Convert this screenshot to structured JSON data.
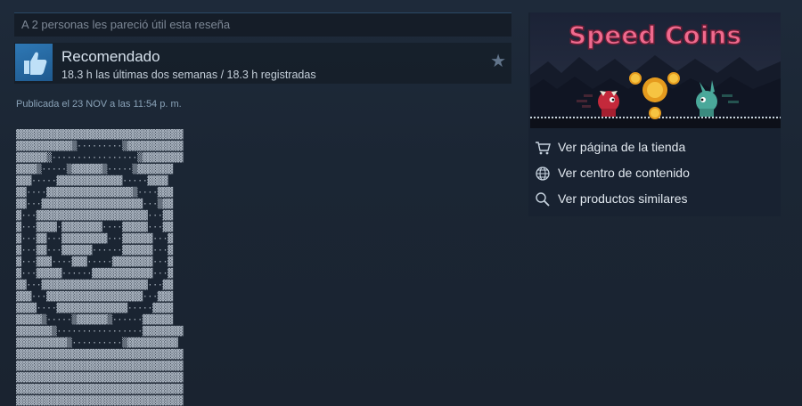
{
  "review": {
    "helpful_text": "A 2 personas les pareció útil esta reseña",
    "recommendation": "Recomendado",
    "hours": "18.3 h las últimas dos semanas / 18.3 h registradas",
    "posted": "Publicada el 23 NOV a las 11:54 p. m.",
    "ascii_art": "▓▓▓▓▓▓▓▓▓▓▓▓▓▓▓▓▓▓▓▓▓▓▓▓▓▓▓▓▓▓▓▓▓\n▓▓▓▓▓▓▓▓▓▓▓▒·········▒▓▓▓▓▓▓▓▓▓▓▓\n▓▓▓▓▓▓▒·················▒▓▓▓▓▓▓▓▓\n▓▓▓▓▒·····▒▓▓▓▓▓▓▒·····▒▓▓▓▓▓▓▓\n▓▓▓·····▓▓▓▓▓▓▓▓▓▓▓▓▓·····▓▓▓▓\n▓▓····▓▓▓▓▓▓▓▓▓▓▓▓▓▓▓▓▓▒····▓▓▓\n▓▓···▓▓▓▓▓▓▓▓▓▓▓▓▓▓▓▓▓▓▓▓···▒▓▓\n▓···▓▓▓▓▓▓▓▓▓▓▓▓▓▓▓▓▓▓▓▓▓▓···▓▓\n▓···▓▓▓▓·▓▓▓▓▓▓▓▓····▓▓▓▓▓···▓▓\n▓···▓▓···▓▓▓▓▓▓▓▓▓···▓▓▓▓▓▓···▓\n▓···▓▓···▓▓▓▓▓▓······▓▓▓▓▓▓···▓\n▓···▓▓▓····▓▓▓·····▓▓▓▓▓▓▓▓···▓\n▓···▓▓▓▓▓······▓▓▓▓▓▓▓▓▓▓▓▓···▓\n▓▓···▓▓▓▓▓▓▓▓▓▓▓▓▓▓▓▓▓▓▓▓▓···▓▓\n▓▓▓···▓▓▓▓▓▓▓▓▓▓▓▓▓▓▓▓▓▓▓···▓▓▓\n▓▓▓▓····▓▓▓▓▓▓▓▓▓▓▓▓▓▓·····▓▓▓▓\n▓▓▓▓▓▒·····▒▓▓▓▓▓▓▒······▓▓▓▓▓▓\n▓▓▓▓▓▓▓▒·················▓▓▓▓▓▓▓▓\n▓▓▓▓▓▓▓▓▓▓▒··········▒▓▓▓▓▓▓▓▓▓▓\n▓▓▓▓▓▓▓▓▓▓▓▓▓▓▓▓▓▓▓▓▓▓▓▓▓▓▓▓▓▓▓▓▓\n▓▓▓▓▓▓▓▓▓▓▓▓▓▓▓▓▓▓▓▓▓▓▓▓▓▓▓▓▓▓▓▓▓\n▓▓▓▓▓▓▓▓▓▓▓▓▓▓▓▓▓▓▓▓▓▓▓▓▓▓▓▓▓▓▓▓▓\n▓▓▓▓▓▓▓▓▓▓▓▓▓▓▓▓▓▓▓▓▓▓▓▓▓▓▓▓▓▓▓▓▓\n▓▓▓▓▓▓▓▓▓▓▓▓▓▓▓▓▓▓▓▓▓▓▓▓▓▓▓▓▓▓▓▓▓"
  },
  "sidebar": {
    "game_title": "Speed Coins",
    "links": [
      {
        "label": "Ver página de la tienda",
        "icon": "cart-icon"
      },
      {
        "label": "Ver centro de contenido",
        "icon": "globe-icon"
      },
      {
        "label": "Ver productos similares",
        "icon": "search-icon"
      }
    ]
  },
  "colors": {
    "accent": "#2e78b5",
    "title_pink": "#f06a8e",
    "text_light": "#e1e8ef"
  }
}
